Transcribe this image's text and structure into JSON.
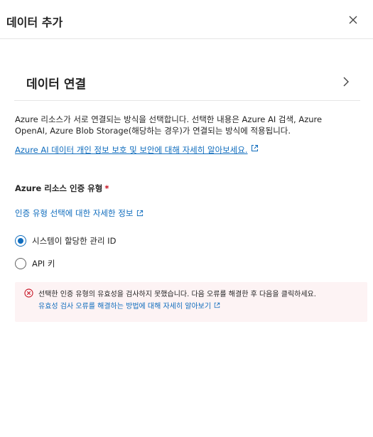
{
  "header": {
    "title": "데이터 추가",
    "close_icon": "close-icon"
  },
  "section": {
    "title": "데이터 연결",
    "chevron_icon": "chevron-right-icon"
  },
  "description": "Azure 리소스가 서로 연결되는 방식을 선택합니다. 선택한 내용은 Azure AI 검색, Azure OpenAI, Azure Blob Storage(해당하는 경우)가 연결되는 방식에 적용됩니다.",
  "privacy_link": {
    "label": "Azure AI 데이터 개인 정보 보호 및 보안에 대해 자세히 알아보세요.",
    "icon": "external-link-icon"
  },
  "auth": {
    "label": "Azure 리소스 인증 유형",
    "required_mark": "*",
    "info_link": "인증 유형 선택에 대한 자세한 정보",
    "options": [
      {
        "label": "시스템이 할당한 관리 ID",
        "selected": true
      },
      {
        "label": "API 키",
        "selected": false
      }
    ]
  },
  "error": {
    "message": "선택한 인증 유형의 유효성을 검사하지 못했습니다. 다음 오류를 해결한 후 다음을 클릭하세요.",
    "link": "유효성 검사 오류를 해결하는 방법에 대해 자세히 알아보기",
    "icon": "error-circle-icon"
  },
  "colors": {
    "accent": "#0f6cbd",
    "error_background": "#fdf3f4",
    "error_icon": "#c50f1f",
    "required": "#c50f1f"
  }
}
